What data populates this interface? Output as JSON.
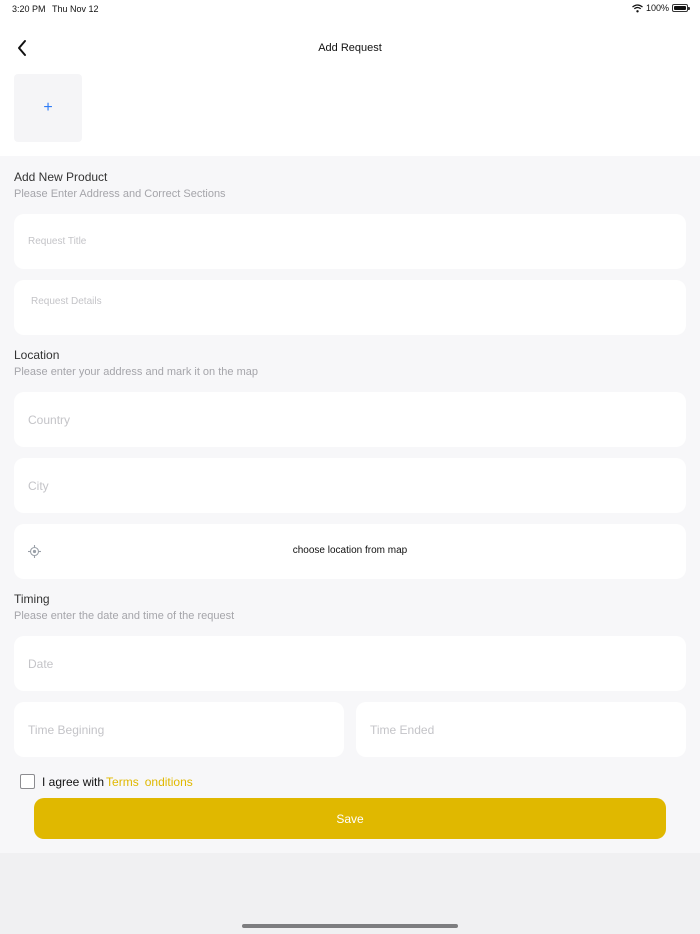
{
  "status_bar": {
    "time": "3:20 PM",
    "date": "Thu Nov 12",
    "battery": "100%",
    "battery_level": 1.0
  },
  "header": {
    "title": "Add Request",
    "back_icon": "chevron-left-icon",
    "add_image_symbol": "+"
  },
  "product_section": {
    "title": "Add New Product",
    "subtitle": "Please Enter Address and Correct Sections",
    "request_title_placeholder": "Request Title",
    "request_details_placeholder": "Request Details"
  },
  "location_section": {
    "title": "Location",
    "subtitle": "Please enter your address and mark it on the map",
    "country_placeholder": "Country",
    "city_placeholder": "City",
    "map_label": "choose location from map",
    "map_icon": "location-target-icon"
  },
  "timing_section": {
    "title": "Timing",
    "subtitle": "Please enter the date and time of the request",
    "date_placeholder": "Date",
    "time_begin_placeholder": "Time Begining",
    "time_end_placeholder": "Time Ended"
  },
  "agreement": {
    "text": "I agree with",
    "terms": "Terms",
    "conditions": "onditions",
    "checked": false
  },
  "save_label": "Save",
  "colors": {
    "accent": "#e0b800",
    "plus": "#2f7cf6",
    "background": "#f7f7f9"
  }
}
